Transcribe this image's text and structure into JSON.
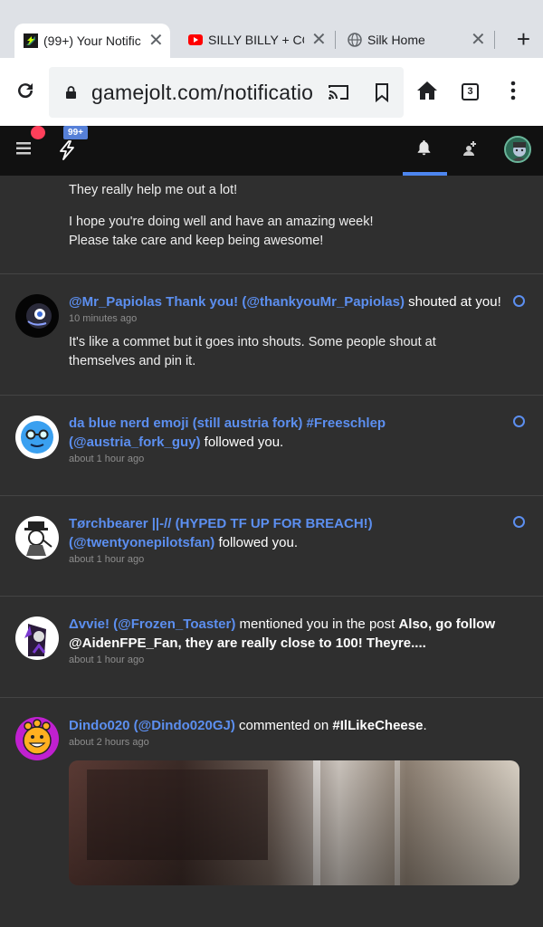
{
  "browser": {
    "tabs": [
      {
        "title": "(99+) Your Notific",
        "favicon": "gamejolt-favicon"
      },
      {
        "title": "SILLY BILLY + COF",
        "favicon": "youtube-favicon"
      },
      {
        "title": "Silk Home",
        "favicon": "globe-favicon"
      }
    ],
    "url": "gamejolt.com/notificatior",
    "tab_count": "3"
  },
  "header": {
    "notification_badge": "99+"
  },
  "feed": {
    "partial": {
      "line1": "They really help me out a lot!",
      "line2": "I hope you're doing well and have an amazing week!",
      "line3": "Please take care and keep being awesome!"
    },
    "items": [
      {
        "user": "@Mr_Papiolas Thank you! (@thankyouMr_Papiolas)",
        "action": " shouted at you!",
        "time": "10 minutes ago",
        "message": "It's like a commet but it goes into shouts. Some people shout at themselves and pin it."
      },
      {
        "user": "da blue nerd emoji (still austria fork) #Freeschlep (@austria_fork_guy)",
        "action": " followed you.",
        "time": "about 1 hour ago"
      },
      {
        "user": "Tørchbearer ||-// (HYPED TF UP FOR BREACH!) (@twentyonepilotsfan)",
        "action": " followed you.",
        "time": "about 1 hour ago"
      },
      {
        "user": "Δvvie! (@Frozen_Toaster)",
        "action": " mentioned you in the post ",
        "post": "Also, go follow @AidenFPE_Fan, they are really close to 100! Theyre....",
        "time": "about 1 hour ago"
      },
      {
        "user": "Dindo020 (@Dindo020GJ)",
        "action": " commented on ",
        "target": "#IlLikeCheese",
        "suffix": ".",
        "time": "about 2 hours ago"
      }
    ]
  },
  "colors": {
    "accent": "#5c8ff0",
    "header_bg": "#111111",
    "feed_bg": "#2f2f2f",
    "badge": "#5680d8",
    "alert": "#ff3f5a"
  }
}
